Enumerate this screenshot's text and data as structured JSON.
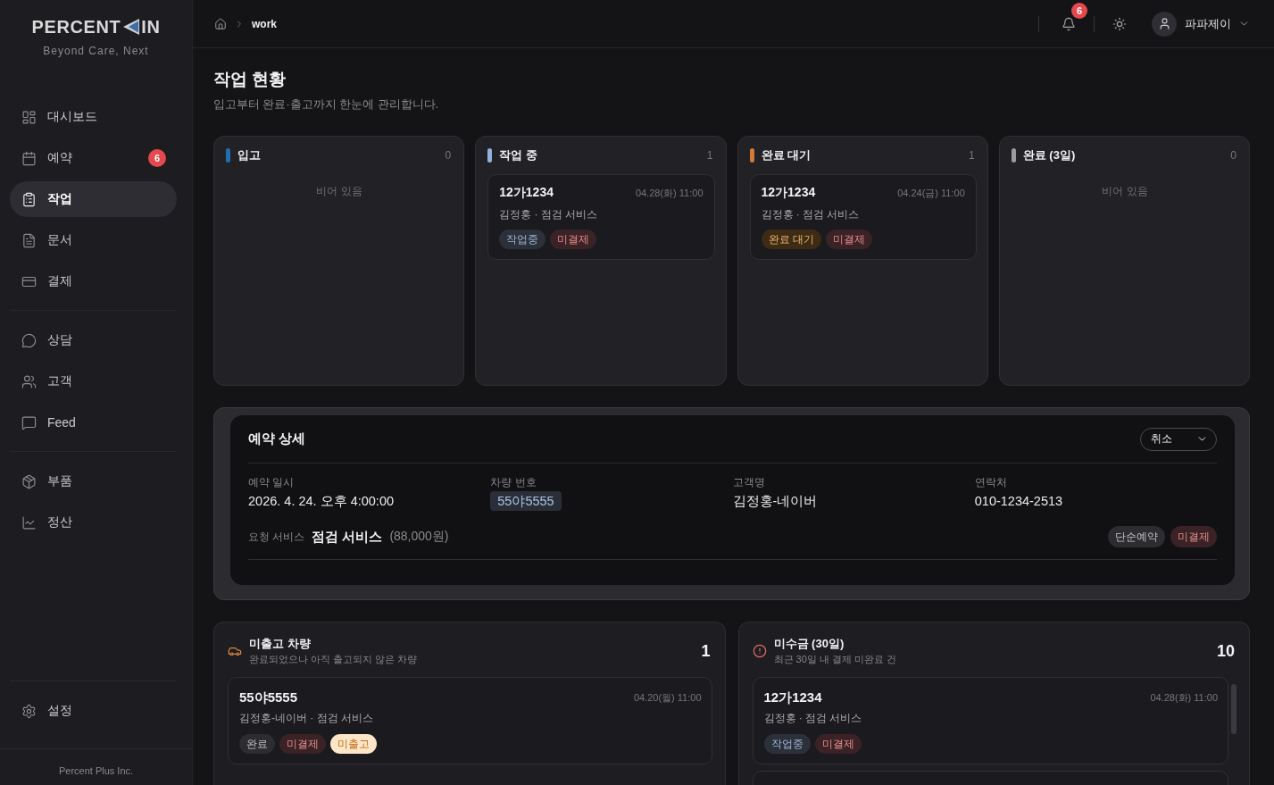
{
  "sidebar": {
    "logo": {
      "left": "PERCENT",
      "right": "IN"
    },
    "tagline": "Beyond Care, Next",
    "groups": [
      {
        "items": [
          {
            "label": "대시보드",
            "selected": false
          },
          {
            "label": "예약",
            "selected": false,
            "badge": "6"
          },
          {
            "label": "작업",
            "selected": true
          },
          {
            "label": "문서",
            "selected": false
          },
          {
            "label": "결제",
            "selected": false
          }
        ]
      },
      {
        "items": [
          {
            "label": "상담",
            "selected": false
          },
          {
            "label": "고객",
            "selected": false
          },
          {
            "label": "Feed",
            "selected": false
          }
        ]
      },
      {
        "items": [
          {
            "label": "부품",
            "selected": false
          },
          {
            "label": "정산",
            "selected": false
          }
        ]
      }
    ],
    "bottom_items": [
      {
        "label": "설정",
        "selected": false
      }
    ],
    "footer": "Percent Plus Inc."
  },
  "topbar": {
    "breadcrumb": {
      "current": "work"
    },
    "notification_count": "6",
    "user": {
      "name": "파파제이"
    }
  },
  "page": {
    "title": "작업 현황",
    "subtitle": "입고부터 완료·출고까지 한눈에 관리합니다."
  },
  "board": {
    "columns": [
      {
        "title": "입고",
        "count": "0",
        "color": "#1f6fb2",
        "empty_text": "비어 있음"
      },
      {
        "title": "작업 중",
        "count": "1",
        "color": "#8fb3d9",
        "cards": [
          {
            "plate": "12가1234",
            "time": "04.28(화) 11:00",
            "summary": "김정홍 · 점검 서비스",
            "tags": [
              {
                "label": "작업중",
                "kind": "working"
              },
              {
                "label": "미결제",
                "kind": "unpaid"
              }
            ]
          }
        ]
      },
      {
        "title": "완료 대기",
        "count": "1",
        "color": "#d07a32",
        "cards": [
          {
            "plate": "12가1234",
            "time": "04.24(금) 11:00",
            "summary": "김정홍 · 점검 서비스",
            "tags": [
              {
                "label": "완료 대기",
                "kind": "waiting"
              },
              {
                "label": "미결제",
                "kind": "unpaid"
              }
            ]
          }
        ]
      },
      {
        "title": "완료 (3일)",
        "count": "0",
        "color": "#9a9a9f",
        "empty_text": "비어 있음"
      }
    ]
  },
  "reservation_detail": {
    "title": "예약 상세",
    "status": {
      "value": "취소"
    },
    "fields": [
      {
        "label": "예약 일시",
        "value": "2026. 4. 24. 오후 4:00:00",
        "kind": "text"
      },
      {
        "label": "차량 번호",
        "value": "55야5555",
        "kind": "chip"
      },
      {
        "label": "고객명",
        "value": "김정홍-네이버",
        "kind": "text"
      },
      {
        "label": "연락처",
        "value": "010-1234-2513",
        "kind": "text"
      }
    ],
    "service": {
      "label": "요청 서비스",
      "name": "점검 서비스",
      "price": "(88,000원)"
    },
    "tags": [
      {
        "label": "단순예약",
        "kind": "neutral"
      },
      {
        "label": "미결제",
        "kind": "unpaid"
      }
    ]
  },
  "panels": [
    {
      "title": "미출고 차량",
      "subtitle": "완료되었으나 아직 출고되지 않은 차량",
      "count": "1",
      "cards": [
        {
          "plate": "55야5555",
          "time": "04.20(월) 11:00",
          "summary": "김정홍-네이버 · 점검 서비스",
          "tags": [
            {
              "label": "완료",
              "kind": "neutral"
            },
            {
              "label": "미결제",
              "kind": "unpaid"
            },
            {
              "label": "미출고",
              "kind": "unreleased"
            }
          ]
        }
      ]
    },
    {
      "title": "미수금 (30일)",
      "subtitle": "최근 30일 내 결제 미완료 건",
      "count": "10",
      "has_more": true,
      "cards": [
        {
          "plate": "12가1234",
          "time": "04.28(화) 11:00",
          "summary": "김정홍 · 점검 서비스",
          "tags": [
            {
              "label": "작업중",
              "kind": "working"
            },
            {
              "label": "미결제",
              "kind": "unpaid"
            }
          ]
        }
      ]
    }
  ]
}
